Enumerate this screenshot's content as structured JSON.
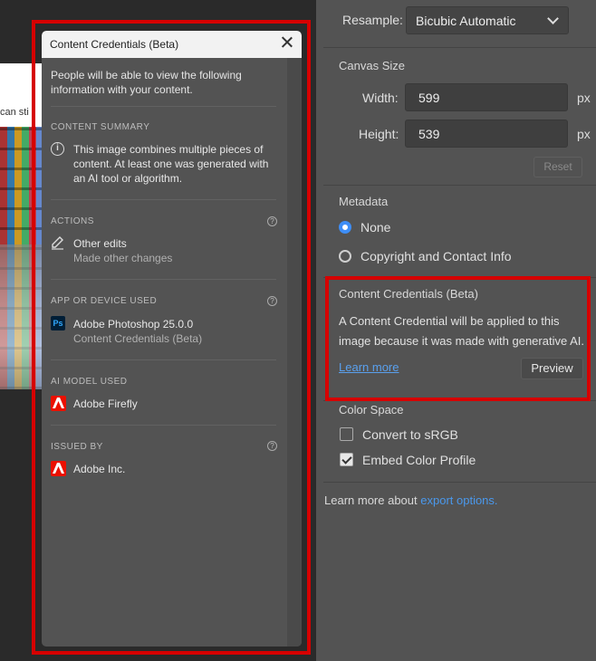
{
  "background": {
    "photo_text": "can sti"
  },
  "export_panel": {
    "resample": {
      "label": "Resample:",
      "value": "Bicubic Automatic"
    },
    "canvas_size": {
      "title": "Canvas Size",
      "width_label": "Width:",
      "width_value": "599",
      "height_label": "Height:",
      "height_value": "539",
      "unit": "px",
      "reset_label": "Reset"
    },
    "metadata": {
      "title": "Metadata",
      "options": [
        "None",
        "Copyright and Contact Info"
      ],
      "selected": "None"
    },
    "content_credentials": {
      "title": "Content Credentials (Beta)",
      "description": "A Content Credential will be applied to this image because it was made with generative AI.",
      "learn_more": "Learn more",
      "preview_label": "Preview"
    },
    "color_space": {
      "title": "Color Space",
      "convert_label": "Convert to sRGB",
      "convert_checked": false,
      "embed_label": "Embed Color Profile",
      "embed_checked": true
    },
    "footer": {
      "prefix": "Learn more about",
      "link": "export options."
    }
  },
  "popup": {
    "title": "Content Credentials (Beta)",
    "intro": "People will be able to view the following information with your content.",
    "content_summary": {
      "heading": "CONTENT SUMMARY",
      "text": "This image combines multiple pieces of content. At least one was generated with an AI tool or algorithm."
    },
    "actions": {
      "heading": "ACTIONS",
      "item": "Other edits",
      "sub": "Made other changes"
    },
    "app_used": {
      "heading": "APP OR DEVICE USED",
      "item": "Adobe Photoshop 25.0.0",
      "sub": "Content Credentials (Beta)",
      "icon_text": "Ps"
    },
    "ai_model": {
      "heading": "AI MODEL USED",
      "item": "Adobe Firefly"
    },
    "issued_by": {
      "heading": "ISSUED BY",
      "item": "Adobe Inc."
    },
    "help_glyph": "?",
    "info_glyph": "i"
  },
  "colors": {
    "highlight": "#d60000",
    "link": "#4a98ec",
    "adobe_red": "#eb1000"
  }
}
